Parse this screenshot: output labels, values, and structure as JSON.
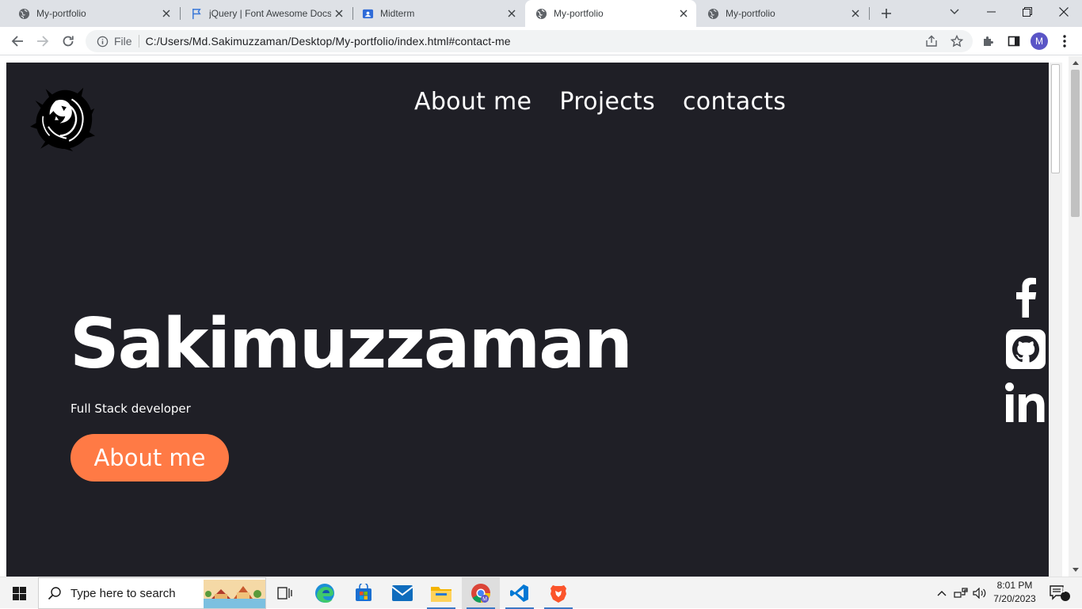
{
  "browser": {
    "tabs": [
      {
        "title": "My-portfolio",
        "icon": "globe-icon",
        "active": false
      },
      {
        "title": "jQuery | Font Awesome Docs",
        "icon": "flag-icon",
        "active": false
      },
      {
        "title": "Midterm",
        "icon": "classroom-icon",
        "active": false
      },
      {
        "title": "My-portfolio",
        "icon": "globe-icon",
        "active": true
      },
      {
        "title": "My-portfolio",
        "icon": "globe-icon",
        "active": false
      }
    ],
    "address_scheme_label": "File",
    "url": "C:/Users/Md.Sakimuzzaman/Desktop/My-portfolio/index.html#contact-me",
    "profile_initial": "M"
  },
  "page": {
    "nav": [
      "About me",
      "Projects",
      "contacts"
    ],
    "name": "Sakimuzzaman",
    "role": "Full Stack developer",
    "cta": "About me",
    "social": [
      "facebook-icon",
      "github-icon",
      "linkedin-icon"
    ],
    "colors": {
      "background": "#1f1f26",
      "accent": "#ff7a45",
      "text": "#ffffff"
    }
  },
  "taskbar": {
    "search_placeholder": "Type here to search",
    "time": "8:01 PM",
    "date": "7/20/2023",
    "notification_count": "1"
  }
}
